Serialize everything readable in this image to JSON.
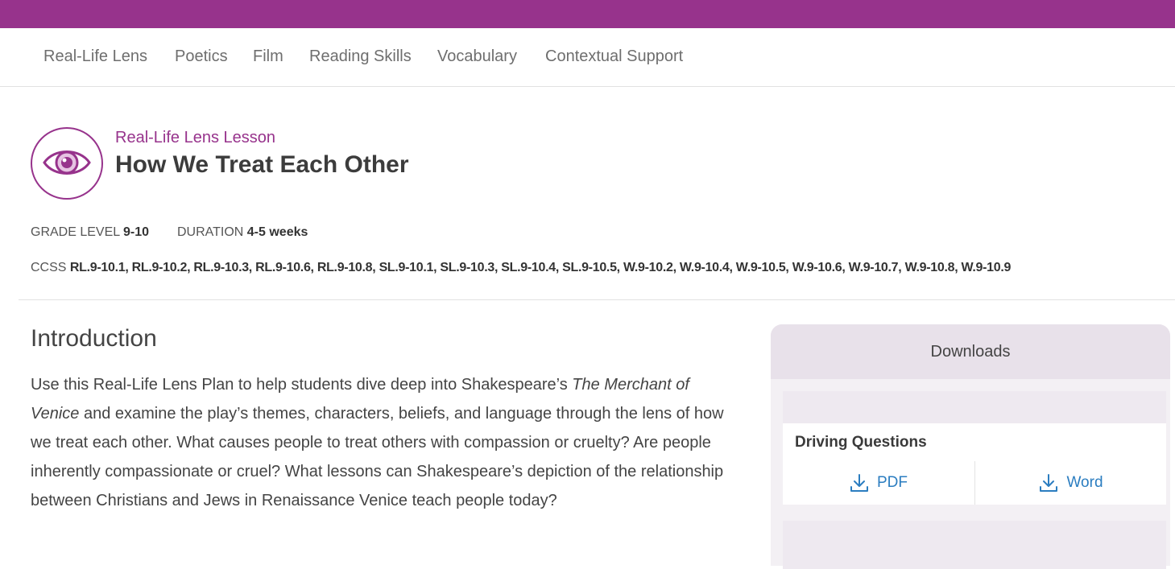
{
  "colors": {
    "accent": "#97338c",
    "link": "#2b7dc0",
    "text": "#3c3c3c"
  },
  "subnav": {
    "items": [
      {
        "label": "Real-Life Lens"
      },
      {
        "label": "Poetics"
      },
      {
        "label": "Film"
      },
      {
        "label": "Reading Skills"
      },
      {
        "label": "Vocabulary"
      },
      {
        "label": "Contextual Support"
      }
    ]
  },
  "lesson": {
    "icon": "eye-icon",
    "kicker": "Real-Life Lens Lesson",
    "title": "How We Treat Each Other",
    "grade_label": "GRADE LEVEL",
    "grade_value": "9-10",
    "duration_label": "DURATION",
    "duration_value": "4-5 weeks",
    "ccss_label": "CCSS",
    "ccss_value": "RL.9-10.1, RL.9-10.2, RL.9-10.3, RL.9-10.6, RL.9-10.8, SL.9-10.1, SL.9-10.3, SL.9-10.4, SL.9-10.5, W.9-10.2, W.9-10.4, W.9-10.5, W.9-10.6, W.9-10.7, W.9-10.8, W.9-10.9"
  },
  "intro": {
    "heading": "Introduction",
    "p_before": "Use this Real-Life Lens Plan to help students dive deep into Shakespeare’s ",
    "p_italic": "The Merchant of Venice",
    "p_after": " and examine the play’s themes, characters, beliefs, and language through the lens of how we treat each other. What causes people to treat others with compassion or cruelty? Are people inherently compassionate or cruel? What lessons can Shakespeare’s depiction of the relationship between Christians and Jews in Renaissance Venice teach people today?"
  },
  "downloads": {
    "heading": "Downloads",
    "items": [
      {
        "title": "Driving Questions",
        "pdf_label": "PDF",
        "word_label": "Word",
        "icon": "download-icon"
      }
    ]
  }
}
